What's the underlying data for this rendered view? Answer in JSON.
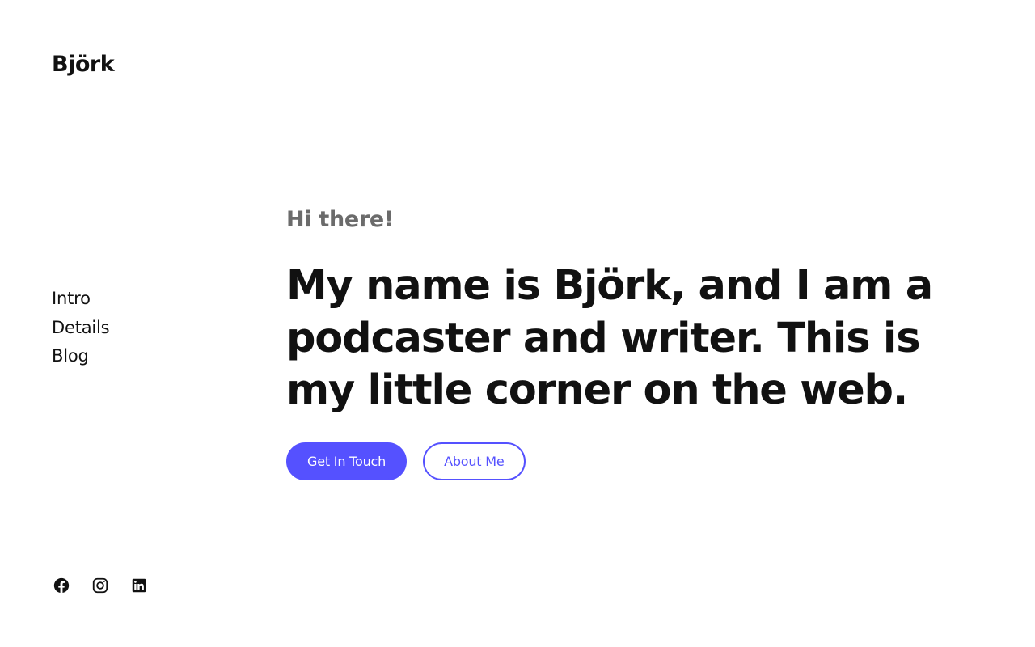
{
  "header": {
    "site_title": "Björk"
  },
  "nav": {
    "items": [
      {
        "label": "Intro"
      },
      {
        "label": "Details"
      },
      {
        "label": "Blog"
      }
    ]
  },
  "hero": {
    "greeting": "Hi there!",
    "headline": "My name is Björk, and I am a podcaster and writer. This is my little corner on the web.",
    "primary_button": "Get In Touch",
    "secondary_button": "About Me"
  },
  "social": {
    "icons": [
      "facebook-icon",
      "instagram-icon",
      "linkedin-icon"
    ]
  },
  "colors": {
    "accent": "#5551ff",
    "text": "#111111",
    "muted": "#6b6b6b",
    "background": "#ffffff"
  }
}
